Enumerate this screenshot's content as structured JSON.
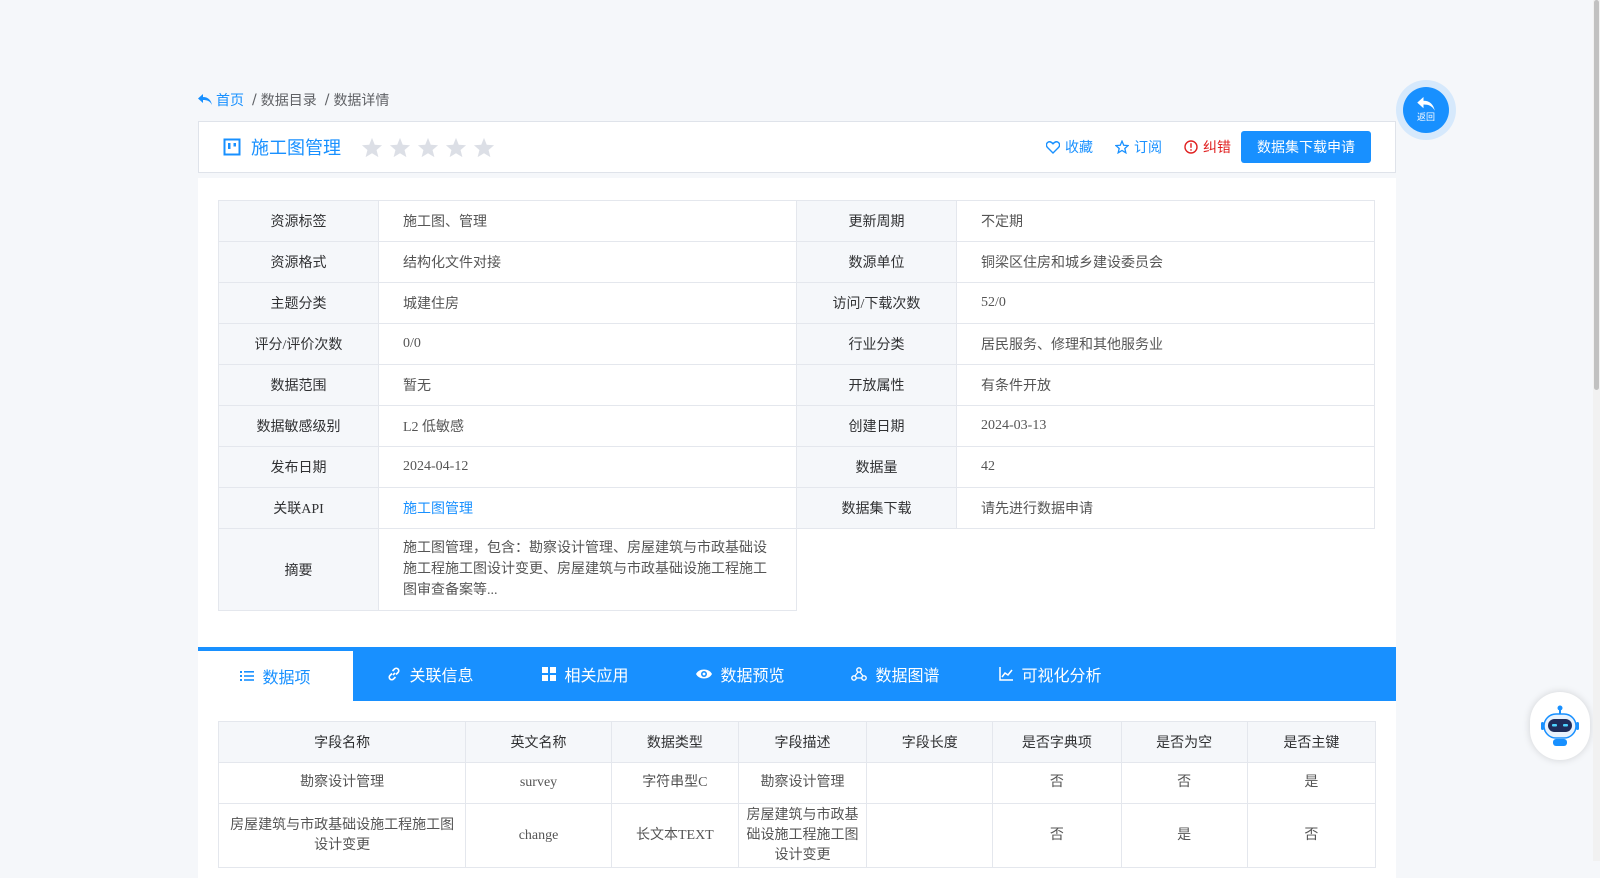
{
  "breadcrumb": {
    "home": "首页",
    "items": [
      "数据目录",
      "数据详情"
    ],
    "separator": "/"
  },
  "title": "施工图管理",
  "rating": {
    "value": 0,
    "max": 5
  },
  "actions": {
    "favorite": "收藏",
    "subscribe": "订阅",
    "correct": "纠错",
    "apply": "数据集下载申请"
  },
  "back": {
    "label": "返回"
  },
  "info": {
    "rows": [
      {
        "k1": "资源标签",
        "v1": "施工图、管理",
        "k2": "更新周期",
        "v2": "不定期"
      },
      {
        "k1": "资源格式",
        "v1": "结构化文件对接",
        "k2": "数源单位",
        "v2": "铜梁区住房和城乡建设委员会"
      },
      {
        "k1": "主题分类",
        "v1": "城建住房",
        "k2": "访问/下载次数",
        "v2": "52/0"
      },
      {
        "k1": "评分/评价次数",
        "v1": "0/0",
        "k2": "行业分类",
        "v2": "居民服务、修理和其他服务业"
      },
      {
        "k1": "数据范围",
        "v1": "暂无",
        "k2": "开放属性",
        "v2": "有条件开放"
      },
      {
        "k1": "数据敏感级别",
        "v1": "L2 低敏感",
        "k2": "创建日期",
        "v2": "2024-03-13"
      },
      {
        "k1": "发布日期",
        "v1": "2024-04-12",
        "k2": "数据量",
        "v2": "42"
      },
      {
        "k1": "关联API",
        "v1": "施工图管理",
        "k2": "数据集下载",
        "v2": "请先进行数据申请"
      }
    ],
    "summary_label": "摘要",
    "summary": "施工图管理，包含：勘察设计管理、房屋建筑与市政基础设施工程施工图设计变更、房屋建筑与市政基础设施工程施工图审查备案等..."
  },
  "tabs": [
    {
      "label": "数据项",
      "icon": "list-icon"
    },
    {
      "label": "关联信息",
      "icon": "link-icon"
    },
    {
      "label": "相关应用",
      "icon": "grid-icon"
    },
    {
      "label": "数据预览",
      "icon": "eye-icon"
    },
    {
      "label": "数据图谱",
      "icon": "graph-icon"
    },
    {
      "label": "可视化分析",
      "icon": "chart-icon"
    }
  ],
  "fields": {
    "headers": [
      "字段名称",
      "英文名称",
      "数据类型",
      "字段描述",
      "字段长度",
      "是否字典项",
      "是否为空",
      "是否主键"
    ],
    "rows": [
      [
        "勘察设计管理",
        "survey",
        "字符串型C",
        "勘察设计管理",
        "",
        "否",
        "否",
        "是"
      ],
      [
        "房屋建筑与市政基础设施工程施工图设计变更",
        "change",
        "长文本TEXT",
        "房屋建筑与市政基础设施工程施工图设计变更",
        "",
        "否",
        "是",
        "否"
      ]
    ]
  },
  "colors": {
    "primary": "#1890ff",
    "danger": "#e02020",
    "border": "#e4e7ed",
    "label_bg": "#f5f7fa"
  }
}
